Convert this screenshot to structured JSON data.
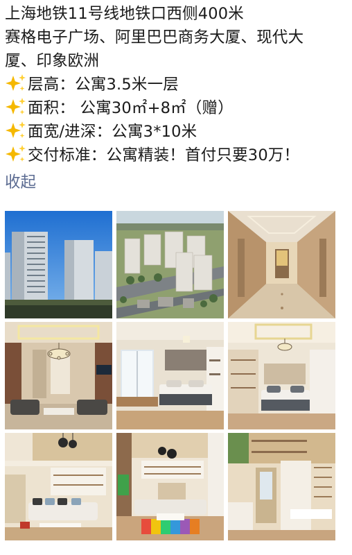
{
  "post": {
    "lines": [
      "上海地铁11号线地铁口西侧400米",
      "赛格电子广场、阿里巴巴商务大厦、现代大",
      "厦、印象欧洲",
      "层高：公寓3.5米一层",
      "面积： 公寓30㎡+8㎡（赠）",
      "面宽/进深：公寓3*10米",
      "交付标准：公寓精装！首付只要30万！"
    ],
    "bullet_icon": "sparkles-icon",
    "collapse_label": "收起"
  },
  "photos": [
    {
      "name": "photo-tower-exterior",
      "subject": "high-rise apartment towers under blue sky"
    },
    {
      "name": "photo-aerial-complex",
      "subject": "aerial rendering of apartment complex"
    },
    {
      "name": "photo-corridor",
      "subject": "lit hallway with doors"
    },
    {
      "name": "photo-living-chandelier",
      "subject": "living room with chandelier"
    },
    {
      "name": "photo-bedroom-window",
      "subject": "bedroom with large window"
    },
    {
      "name": "photo-bedroom-loft",
      "subject": "bedroom with wall shelving"
    },
    {
      "name": "photo-loft-living",
      "subject": "loft living room with pendant lamps"
    },
    {
      "name": "photo-loft-rug",
      "subject": "loft living room with colorful rug"
    },
    {
      "name": "photo-loft-kitchen",
      "subject": "loft kitchen and stairs"
    }
  ],
  "colors": {
    "text": "#1a1a1a",
    "link": "#5b6b91",
    "sparkle": "#f5b800"
  }
}
